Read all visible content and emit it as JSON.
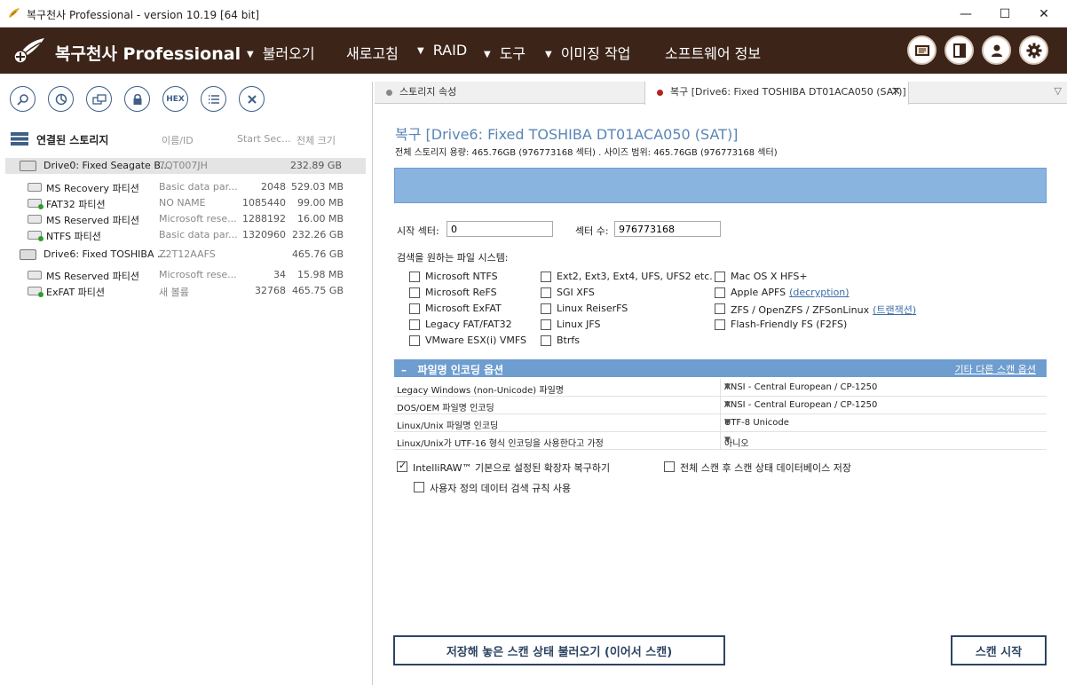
{
  "window": {
    "title": "복구천사 Professional - version 10.19 [64 bit]",
    "minimize": "—",
    "maximize": "☐",
    "close": "✕"
  },
  "menubar": {
    "brand": "복구천사 Professional",
    "items": [
      {
        "label": "불러오기",
        "has_arrow": true
      },
      {
        "label": "새로고침",
        "has_arrow": false
      },
      {
        "label": "RAID",
        "has_arrow": true
      },
      {
        "label": "도구",
        "has_arrow": true
      },
      {
        "label": "이미징 작업",
        "has_arrow": true
      },
      {
        "label": "소프트웨어 정보",
        "has_arrow": false
      }
    ],
    "arrow_glyph": "▼",
    "icons": [
      "chat-icon",
      "panel-icon",
      "user-icon",
      "gear-icon"
    ]
  },
  "toolbar": {
    "icons": [
      "search-icon",
      "pie-chart-icon",
      "copy-icon",
      "lock-icon",
      "hex-icon",
      "list-icon",
      "close-icon"
    ],
    "hex_label": "HEX"
  },
  "tree": {
    "header": {
      "title": "연결된 스토리지",
      "col_name": "이름/ID",
      "col_start": "Start Sec...",
      "col_size": "전체 크기"
    },
    "rows": [
      {
        "type": "disk",
        "name": "Drive0: Fixed Seagate B...",
        "id": "7QT007JH",
        "start": "",
        "size": "232.89 GB",
        "selected": true
      },
      {
        "type": "part",
        "name": "MS Recovery 파티션",
        "id": "Basic data par...",
        "start": "2048",
        "size": "529.03 MB",
        "green": false
      },
      {
        "type": "part",
        "name": "FAT32 파티션",
        "id": "NO NAME",
        "start": "1085440",
        "size": "99.00 MB",
        "green": true
      },
      {
        "type": "part",
        "name": "MS Reserved 파티션",
        "id": "Microsoft rese...",
        "start": "1288192",
        "size": "16.00 MB",
        "green": false
      },
      {
        "type": "part",
        "name": "NTFS 파티션",
        "id": "Basic data par...",
        "start": "1320960",
        "size": "232.26 GB",
        "green": true
      },
      {
        "type": "disk",
        "name": "Drive6: Fixed TOSHIBA ...",
        "id": "Z2T12AAFS",
        "start": "",
        "size": "465.76 GB",
        "selected": false
      },
      {
        "type": "part",
        "name": "MS Reserved 파티션",
        "id": "Microsoft rese...",
        "start": "34",
        "size": "15.98 MB",
        "green": false
      },
      {
        "type": "part",
        "name": "ExFAT 파티션",
        "id": "새 볼륨",
        "start": "32768",
        "size": "465.75 GB",
        "green": true
      }
    ]
  },
  "tabs": [
    {
      "label": "스토리지 속성",
      "dot_color": "#888888",
      "active": false
    },
    {
      "label": "복구 [Drive6: Fixed TOSHIBA DT01ACA050 (SAT)]",
      "dot_color": "#b22222",
      "active": true
    }
  ],
  "tab_close": "✕",
  "tab_overflow": "▽",
  "recover": {
    "title": "복구 [Drive6: Fixed TOSHIBA DT01ACA050 (SAT)]",
    "subtitle": "전체 스토리지 용량: 465.76GB (976773168 섹터) . 사이즈 범위: 465.76GB (976773168 섹터)",
    "start_label": "시작 섹터:",
    "start_value": "0",
    "count_label": "섹터 수:",
    "count_value": "976773168",
    "fs_label": "검색을 원하는 파일 시스템:",
    "fs_cols": [
      [
        "Microsoft NTFS",
        "Microsoft ReFS",
        "Microsoft ExFAT",
        "Legacy FAT/FAT32",
        "VMware ESX(i) VMFS"
      ],
      [
        "Ext2, Ext3, Ext4, UFS, UFS2 etc.",
        "SGI XFS",
        "Linux ReiserFS",
        "Linux JFS",
        "Btrfs"
      ],
      [
        "Mac OS X HFS+",
        "Apple APFS",
        "ZFS / OpenZFS / ZFSonLinux",
        "Flash-Friendly FS (F2FS)"
      ]
    ],
    "apfs_link": "(decryption)",
    "zfs_link": "(트랜잭션)",
    "section_title": "파일명 인코딩 옵션",
    "section_toggle": "–",
    "section_more": "기타 다른 스캔 옵션",
    "options": [
      {
        "key": "Legacy Windows (non-Unicode) 파일명",
        "value": "ANSI - Central European / CP-1250"
      },
      {
        "key": "DOS/OEM 파일명 인코딩",
        "value": "ANSI - Central European / CP-1250"
      },
      {
        "key": "Linux/Unix 파일명 인코딩",
        "value": "UTF-8 Unicode"
      },
      {
        "key": "Linux/Unix가 UTF-16 형식 인코딩을 사용한다고 가정",
        "value": "아니오"
      }
    ],
    "dd_glyph": "▼",
    "intelliraw": "IntelliRAW™ 기본으로 설정된 확장자 복구하기",
    "save_state": "전체 스캔 후 스캔 상태 데이터베이스 저장",
    "custom_rules": "사용자 정의 데이터 검색 규칙 사용",
    "load_button": "저장해 놓은 스캔 상태 불러오기 (이어서 스캔)",
    "start_button": "스캔 시작"
  }
}
